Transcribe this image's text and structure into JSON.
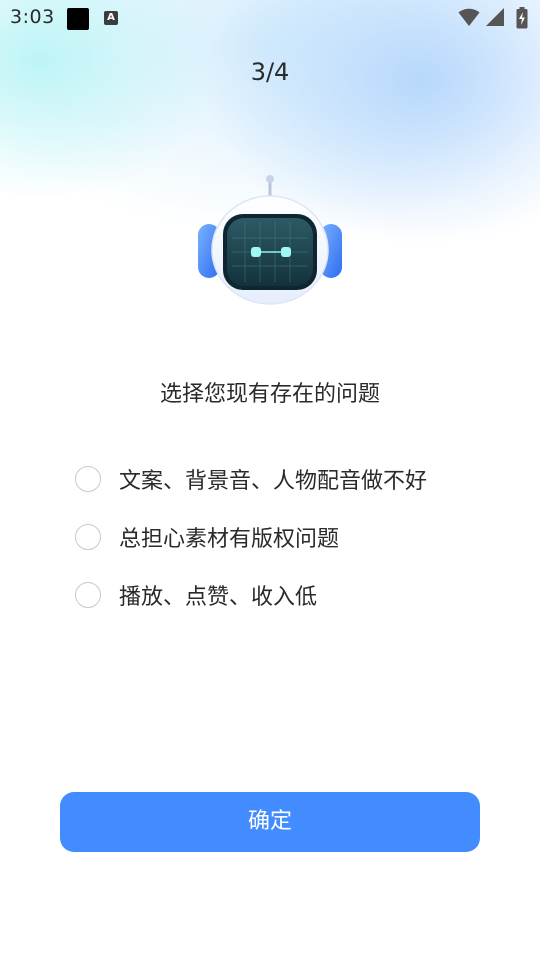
{
  "status_bar": {
    "time": "3:03",
    "notification_icons": [
      "black-square-icon",
      "a-text-icon"
    ],
    "system_icons": [
      "wifi-icon",
      "cellular-signal-icon",
      "battery-charging-icon"
    ]
  },
  "step_indicator": "3/4",
  "question": "选择您现有存在的问题",
  "options": [
    {
      "label": "文案、背景音、人物配音做不好",
      "selected": false
    },
    {
      "label": "总担心素材有版权问题",
      "selected": false
    },
    {
      "label": "播放、点赞、收入低",
      "selected": false
    }
  ],
  "confirm_label": "确定",
  "colors": {
    "accent": "#428cff",
    "radio_border": "#c9c9c9",
    "text": "#2a2a2a"
  }
}
